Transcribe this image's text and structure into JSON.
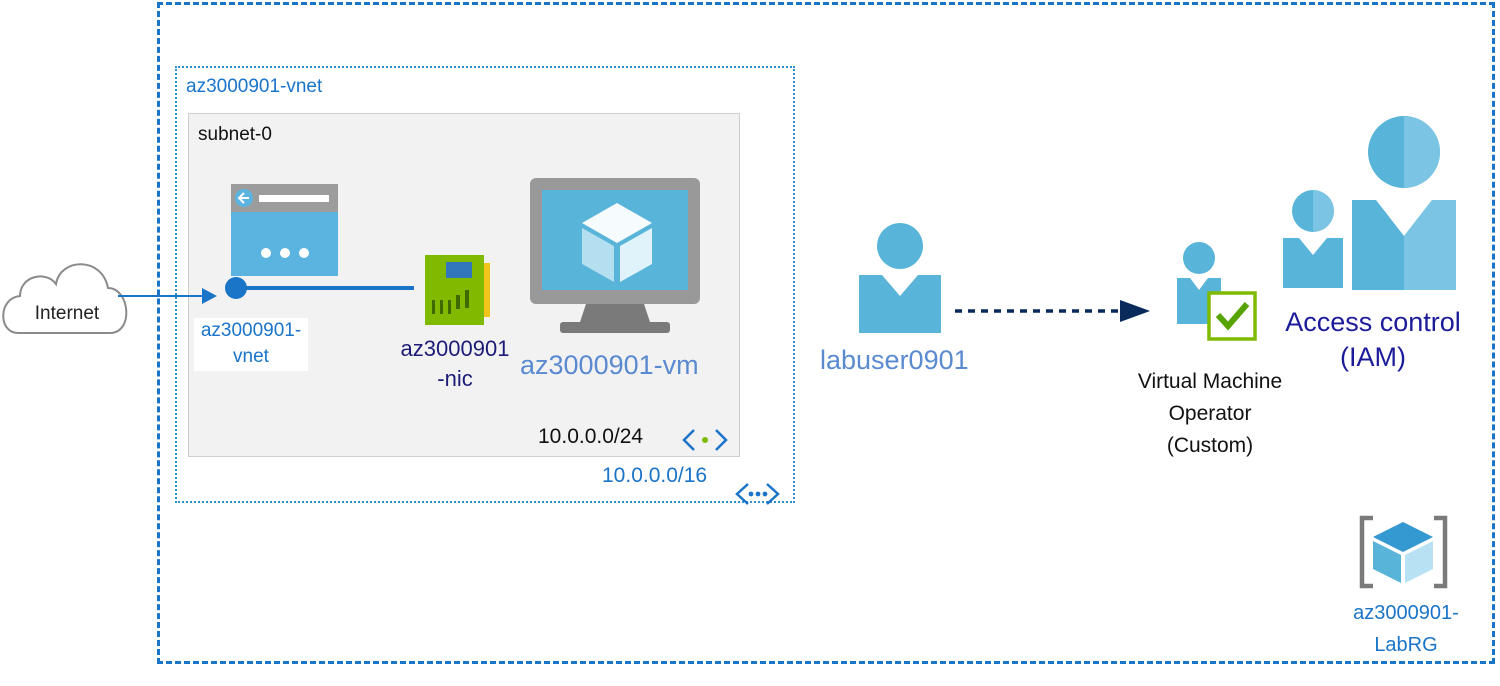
{
  "resource_group": {
    "name": "az3000901-\nLabRG"
  },
  "vnet": {
    "name": "az3000901-vnet",
    "cidr": "10.0.0.0/16"
  },
  "subnet": {
    "name": "subnet-0",
    "cidr": "10.0.0.0/24"
  },
  "public_ip": {
    "label": "az3000901-\nvnet"
  },
  "nic": {
    "label": "az3000901\n-nic"
  },
  "vm": {
    "label": "az3000901-vm"
  },
  "internet": {
    "label": "Internet"
  },
  "user": {
    "label": "labuser0901"
  },
  "role": {
    "label": "Virtual Machine\nOperator\n(Custom)"
  },
  "iam": {
    "label": "Access control\n(IAM)"
  },
  "colors": {
    "border_blue": "#1a74c8",
    "icon_blue": "#59b4d9",
    "dark_navy": "#0a2a5c",
    "nic_green": "#7fba00",
    "check_green": "#57a300"
  }
}
